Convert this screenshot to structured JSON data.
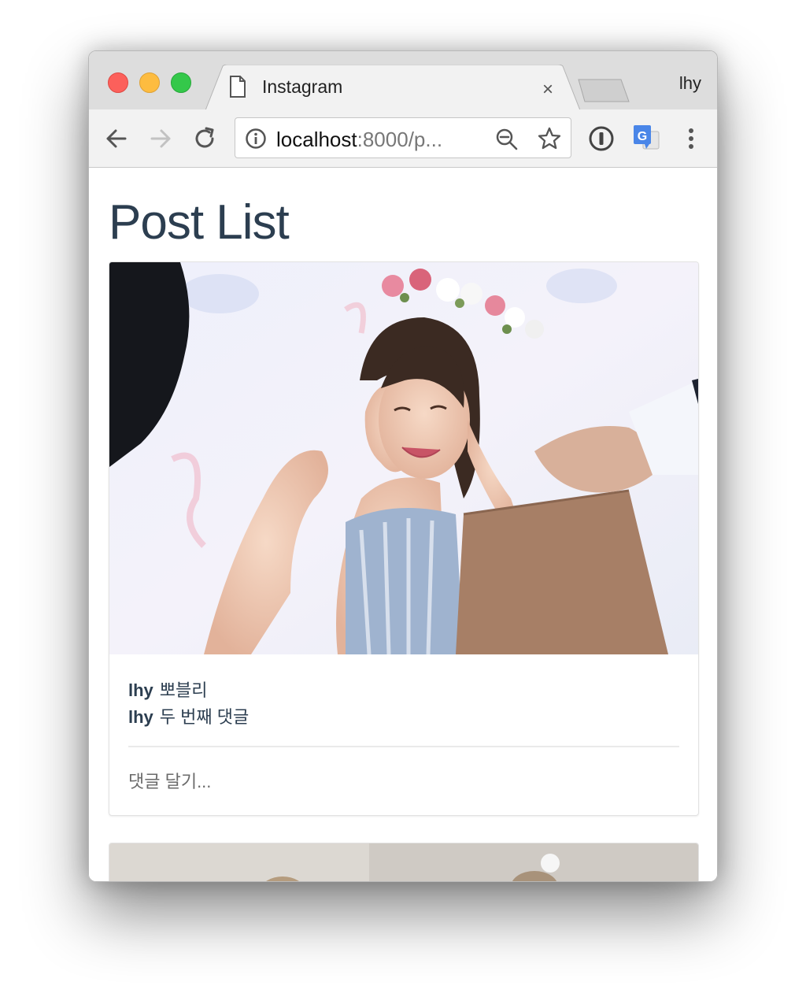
{
  "browser": {
    "tab_title": "Instagram",
    "tab_close": "×",
    "profile_name": "lhy",
    "url_host": "localhost",
    "url_rest": ":8000/p..."
  },
  "page": {
    "title": "Post List"
  },
  "posts": [
    {
      "comments": [
        {
          "author": "lhy",
          "text": "뽀블리"
        },
        {
          "author": "lhy",
          "text": "두 번째 댓글"
        }
      ],
      "comment_placeholder": "댓글 달기..."
    }
  ],
  "colors": {
    "heading": "#2c3e50",
    "tabstrip": "#dddddd",
    "toolbar": "#f2f2f2"
  }
}
